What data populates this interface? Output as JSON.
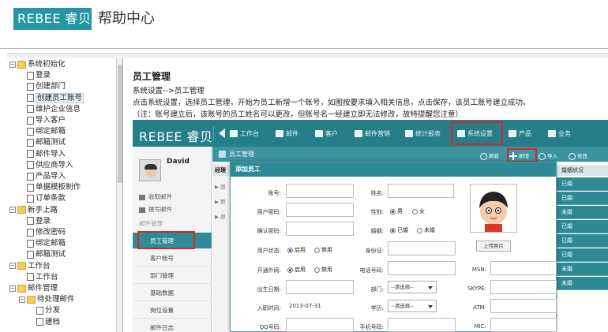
{
  "header": {
    "logo_text": "REBEE 睿贝",
    "title": "帮助中心"
  },
  "tree": {
    "items": [
      {
        "label": "系统初始化",
        "kind": "folder",
        "toggle": "⊟",
        "level": 0
      },
      {
        "label": "登录",
        "kind": "doc",
        "level": 1
      },
      {
        "label": "创建部门",
        "kind": "doc",
        "level": 1
      },
      {
        "label": "创建员工账号",
        "kind": "doc",
        "level": 1,
        "selected": true
      },
      {
        "label": "维护企业信息",
        "kind": "doc",
        "level": 1
      },
      {
        "label": "导入客户",
        "kind": "doc",
        "level": 1
      },
      {
        "label": "绑定邮箱",
        "kind": "doc",
        "level": 1
      },
      {
        "label": "邮箱测试",
        "kind": "doc",
        "level": 1
      },
      {
        "label": "邮件导入",
        "kind": "doc",
        "level": 1
      },
      {
        "label": "供应商导入",
        "kind": "doc",
        "level": 1
      },
      {
        "label": "产品导入",
        "kind": "doc",
        "level": 1
      },
      {
        "label": "单据模板制作",
        "kind": "doc",
        "level": 1
      },
      {
        "label": "订单条款",
        "kind": "doc",
        "level": 1
      },
      {
        "label": "新手上路",
        "kind": "folder",
        "toggle": "⊟",
        "level": 0
      },
      {
        "label": "登录",
        "kind": "doc",
        "level": 1
      },
      {
        "label": "修改密码",
        "kind": "doc",
        "level": 1
      },
      {
        "label": "绑定邮箱",
        "kind": "doc",
        "level": 1
      },
      {
        "label": "邮箱测试",
        "kind": "doc",
        "level": 1
      },
      {
        "label": "工作台",
        "kind": "folder",
        "toggle": "⊟",
        "level": 0
      },
      {
        "label": "工作台",
        "kind": "doc",
        "level": 1
      },
      {
        "label": "邮件管理",
        "kind": "folder",
        "toggle": "⊟",
        "level": 0
      },
      {
        "label": "待处理邮件",
        "kind": "folder",
        "toggle": "⊟",
        "level": 1
      },
      {
        "label": "分发",
        "kind": "doc",
        "level": 2
      },
      {
        "label": "建档",
        "kind": "doc",
        "level": 2
      }
    ]
  },
  "content": {
    "heading": "员工管理",
    "path": "系统设置-->员工管理",
    "instruction": "点击系统设置，选择员工管理，开始为员工新增一个账号，如图按要求填入相关信息，点击保存，该员工账号建立成功。",
    "note": "（注：账号建立后，该账号的员工姓名可以更改，但账号名一经建立即无法修改，故特提醒您注意）"
  },
  "app": {
    "logo": "REBEE 睿贝",
    "nav": [
      "工作台",
      "邮件",
      "客户",
      "邮件营销",
      "统计报表",
      "系统设置",
      "产品",
      "业务"
    ],
    "user": "David",
    "side_items": [
      "收取邮件",
      "撰写邮件"
    ],
    "side_group": "邮件管理",
    "side_subs": [
      "员工管理",
      "客户帐号",
      "部门管理",
      "基础数据",
      "岗位设置",
      "邮件日志"
    ],
    "section_title": "员工管理",
    "actions": {
      "refresh": "刷新",
      "add": "新增",
      "import": "导入",
      "edit": "修改"
    },
    "left_head": "经理",
    "left_rows": [
      "▶ 国",
      "▶ 职",
      "▶ 原"
    ],
    "status_head": "婚姻状况",
    "status_values": [
      "已婚",
      "已婚",
      "未婚",
      "已婚",
      "已婚",
      "已婚",
      "未婚",
      "未婚"
    ],
    "dialog": {
      "title": "添加员工",
      "account": "账号:",
      "name": "姓名:",
      "password": "用户密码:",
      "gender": "性别:",
      "male": "男",
      "female": "女",
      "confirm": "确认密码:",
      "marital": "婚姻:",
      "married": "已婚",
      "single": "未婚",
      "user_status": "用户状态:",
      "enable": "启用",
      "disable": "禁用",
      "id_card": "身份证:",
      "open_ip": "开通外网:",
      "phone": "电话号码:",
      "msn": "MSN:",
      "birth": "出生日期:",
      "dept": "部门:",
      "select_placeholder": "--请选择--",
      "skype": "SKYPE:",
      "hire_date": "入职时间:",
      "hire_date_value": "2013-07-31",
      "education": "学历:",
      "atm": "ATM:",
      "qq": "QQ号码:",
      "mobile": "手机号码:",
      "mic": "MIC:",
      "upload": "上传照片"
    }
  }
}
